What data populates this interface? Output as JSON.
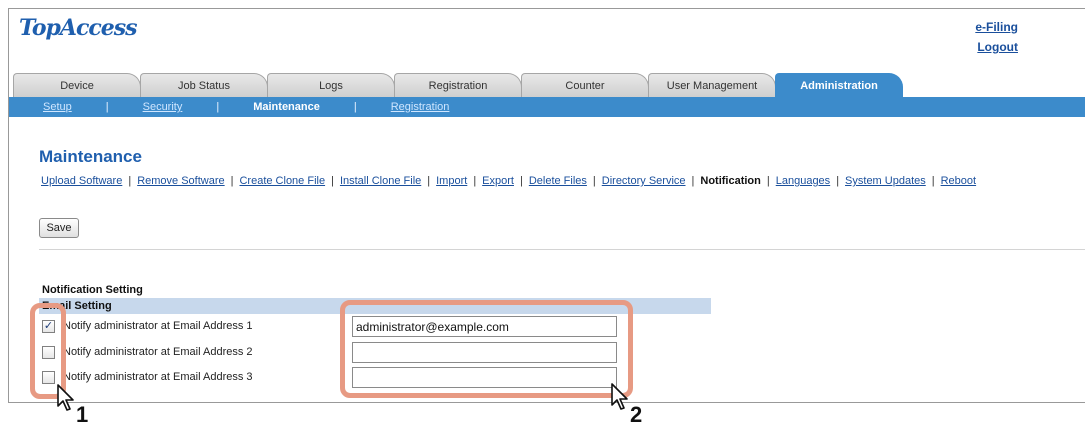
{
  "header": {
    "logo": "TopAccess",
    "efiling_link": "e-Filing",
    "logout_link": "Logout"
  },
  "tabs": [
    "Device",
    "Job Status",
    "Logs",
    "Registration",
    "Counter",
    "User Management",
    "Administration"
  ],
  "active_tab": "Administration",
  "subnav": {
    "items": [
      "Setup",
      "Security",
      "Maintenance",
      "Registration"
    ],
    "current": "Maintenance",
    "separator": "|"
  },
  "page": {
    "title": "Maintenance",
    "links": [
      "Upload Software",
      "Remove Software",
      "Create Clone File",
      "Install Clone File",
      "Import",
      "Export",
      "Delete Files",
      "Directory Service",
      "Notification",
      "Languages",
      "System Updates",
      "Reboot"
    ],
    "current_link": "Notification",
    "separator": "|"
  },
  "toolbar": {
    "save_label": "Save"
  },
  "notification": {
    "section_title": "Notification Setting",
    "email_setting_label": "Email Setting",
    "rows": [
      {
        "label": "Notify administrator at Email Address 1",
        "checked": true,
        "value": "administrator@example.com"
      },
      {
        "label": "Notify administrator at Email Address 2",
        "checked": false,
        "value": ""
      },
      {
        "label": "Notify administrator at Email Address 3",
        "checked": false,
        "value": ""
      }
    ]
  },
  "annotations": {
    "step1": "1",
    "step2": "2",
    "highlight_color": "#e79a83"
  },
  "colors": {
    "brand_blue": "#1f5fae",
    "nav_blue": "#3c8bcb",
    "link_blue": "#1a4f9c",
    "email_bar": "#c7d8ec"
  }
}
